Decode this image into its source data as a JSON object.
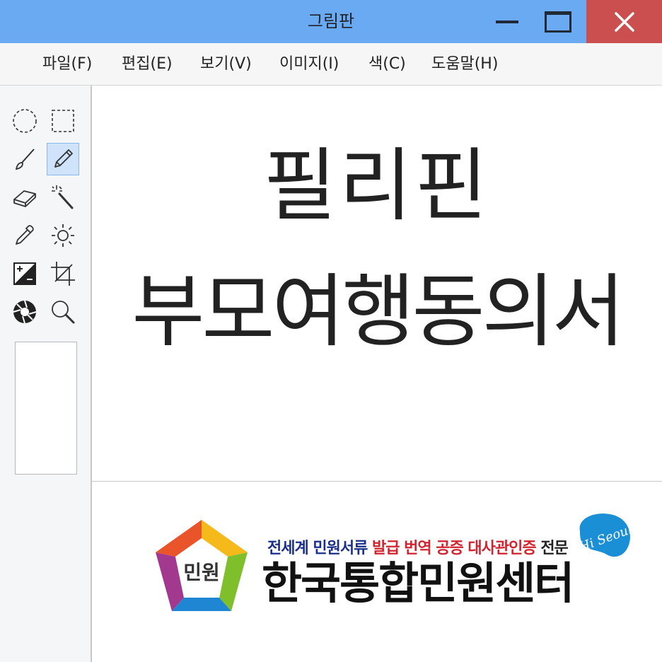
{
  "window": {
    "title": "그림판",
    "controls": {
      "minimize": "minimize",
      "maximize": "maximize",
      "close": "close"
    }
  },
  "menu": [
    "파일(F)",
    "편집(E)",
    "보기(V)",
    "이미지(I)",
    "색(C)",
    "도움말(H)"
  ],
  "tools": [
    {
      "name": "ellipse-select-icon"
    },
    {
      "name": "rect-select-icon"
    },
    {
      "name": "brush-icon"
    },
    {
      "name": "pencil-icon",
      "selected": true
    },
    {
      "name": "eraser-icon"
    },
    {
      "name": "magic-wand-icon"
    },
    {
      "name": "eyedropper-icon"
    },
    {
      "name": "brightness-icon"
    },
    {
      "name": "invert-icon"
    },
    {
      "name": "crop-icon"
    },
    {
      "name": "aperture-icon"
    },
    {
      "name": "zoom-icon"
    }
  ],
  "canvas": {
    "heading_line1": "필리핀",
    "heading_line2": "부모여행동의서"
  },
  "banner": {
    "logo_text": "민원",
    "tagline_part1": "전세계 민원서류",
    "tagline_part2": "발급 번역 공증 대사관인증",
    "tagline_part3": "전문",
    "center_name": "한국통합민원센터",
    "badge_text": "Hi Seoul"
  },
  "colors": {
    "titlebar": "#6aaaf2",
    "close": "#cc4f4f",
    "tagline_blue": "#1a2f8a",
    "tagline_red": "#d2242f",
    "badge": "#1b8fd6"
  }
}
